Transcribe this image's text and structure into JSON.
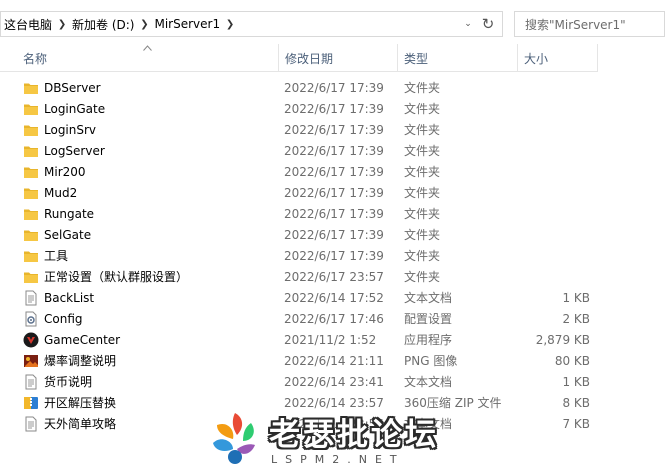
{
  "address": {
    "crumbs": [
      "这台电脑",
      "新加卷 (D:)",
      "MirServer1"
    ],
    "separator": "❯",
    "dropdown": "⌄",
    "refresh": "↻"
  },
  "search": {
    "placeholder": "搜索\"MirServer1\""
  },
  "columns": {
    "name": "名称",
    "date": "修改日期",
    "type": "类型",
    "size": "大小"
  },
  "files": [
    {
      "name": "DBServer",
      "date": "2022/6/17 17:39",
      "type": "文件夹",
      "size": "",
      "icon": "folder-icon"
    },
    {
      "name": "LoginGate",
      "date": "2022/6/17 17:39",
      "type": "文件夹",
      "size": "",
      "icon": "folder-icon"
    },
    {
      "name": "LoginSrv",
      "date": "2022/6/17 17:39",
      "type": "文件夹",
      "size": "",
      "icon": "folder-icon"
    },
    {
      "name": "LogServer",
      "date": "2022/6/17 17:39",
      "type": "文件夹",
      "size": "",
      "icon": "folder-icon"
    },
    {
      "name": "Mir200",
      "date": "2022/6/17 17:39",
      "type": "文件夹",
      "size": "",
      "icon": "folder-icon"
    },
    {
      "name": "Mud2",
      "date": "2022/6/17 17:39",
      "type": "文件夹",
      "size": "",
      "icon": "folder-icon"
    },
    {
      "name": "Rungate",
      "date": "2022/6/17 17:39",
      "type": "文件夹",
      "size": "",
      "icon": "folder-icon"
    },
    {
      "name": "SelGate",
      "date": "2022/6/17 17:39",
      "type": "文件夹",
      "size": "",
      "icon": "folder-icon"
    },
    {
      "name": "工具",
      "date": "2022/6/17 17:39",
      "type": "文件夹",
      "size": "",
      "icon": "folder-icon"
    },
    {
      "name": "正常设置（默认群服设置）",
      "date": "2022/6/17 23:57",
      "type": "文件夹",
      "size": "",
      "icon": "folder-icon"
    },
    {
      "name": "BackList",
      "date": "2022/6/14 17:52",
      "type": "文本文档",
      "size": "1 KB",
      "icon": "text-document-icon"
    },
    {
      "name": "Config",
      "date": "2022/6/17 17:46",
      "type": "配置设置",
      "size": "2 KB",
      "icon": "config-settings-icon"
    },
    {
      "name": "GameCenter",
      "date": "2021/11/2 1:52",
      "type": "应用程序",
      "size": "2,879 KB",
      "icon": "game-app-icon"
    },
    {
      "name": "爆率调整说明",
      "date": "2022/6/14 21:11",
      "type": "PNG 图像",
      "size": "80 KB",
      "icon": "png-image-icon"
    },
    {
      "name": "货币说明",
      "date": "2022/6/14 23:41",
      "type": "文本文档",
      "size": "1 KB",
      "icon": "text-document-icon"
    },
    {
      "name": "开区解压替换",
      "date": "2022/6/14 23:57",
      "type": "360压缩 ZIP 文件",
      "size": "8 KB",
      "icon": "zip-archive-icon"
    },
    {
      "name": "天外简单攻略",
      "date": "2022/6/14 23:56",
      "type": "文本文档",
      "size": "7 KB",
      "icon": "text-document-icon"
    }
  ],
  "watermark": {
    "text": "老瑟批论坛",
    "sub": "LSPM2.NET"
  },
  "colors": {
    "header_text": "#4c607a",
    "folder": "#f6c744",
    "muted_text": "#6d6d6d"
  }
}
